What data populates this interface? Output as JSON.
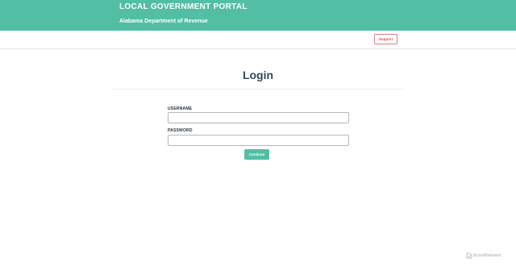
{
  "header": {
    "title": "LOCAL GOVERNMENT PORTAL",
    "subtitle": "Alabama Department of Revenue",
    "background": "#52bea3"
  },
  "navbar": {
    "support_label": "Support",
    "support_color": "#d9534f"
  },
  "main": {
    "heading": "Login",
    "username_label": "USERNAME",
    "username_value": "",
    "password_label": "PASSWORD",
    "password_value": "",
    "continue_label": "Continue",
    "accent": "#52bea3"
  },
  "watermark": {
    "text": "ScanMalware",
    "icon": "scanmalware-logo-icon"
  }
}
